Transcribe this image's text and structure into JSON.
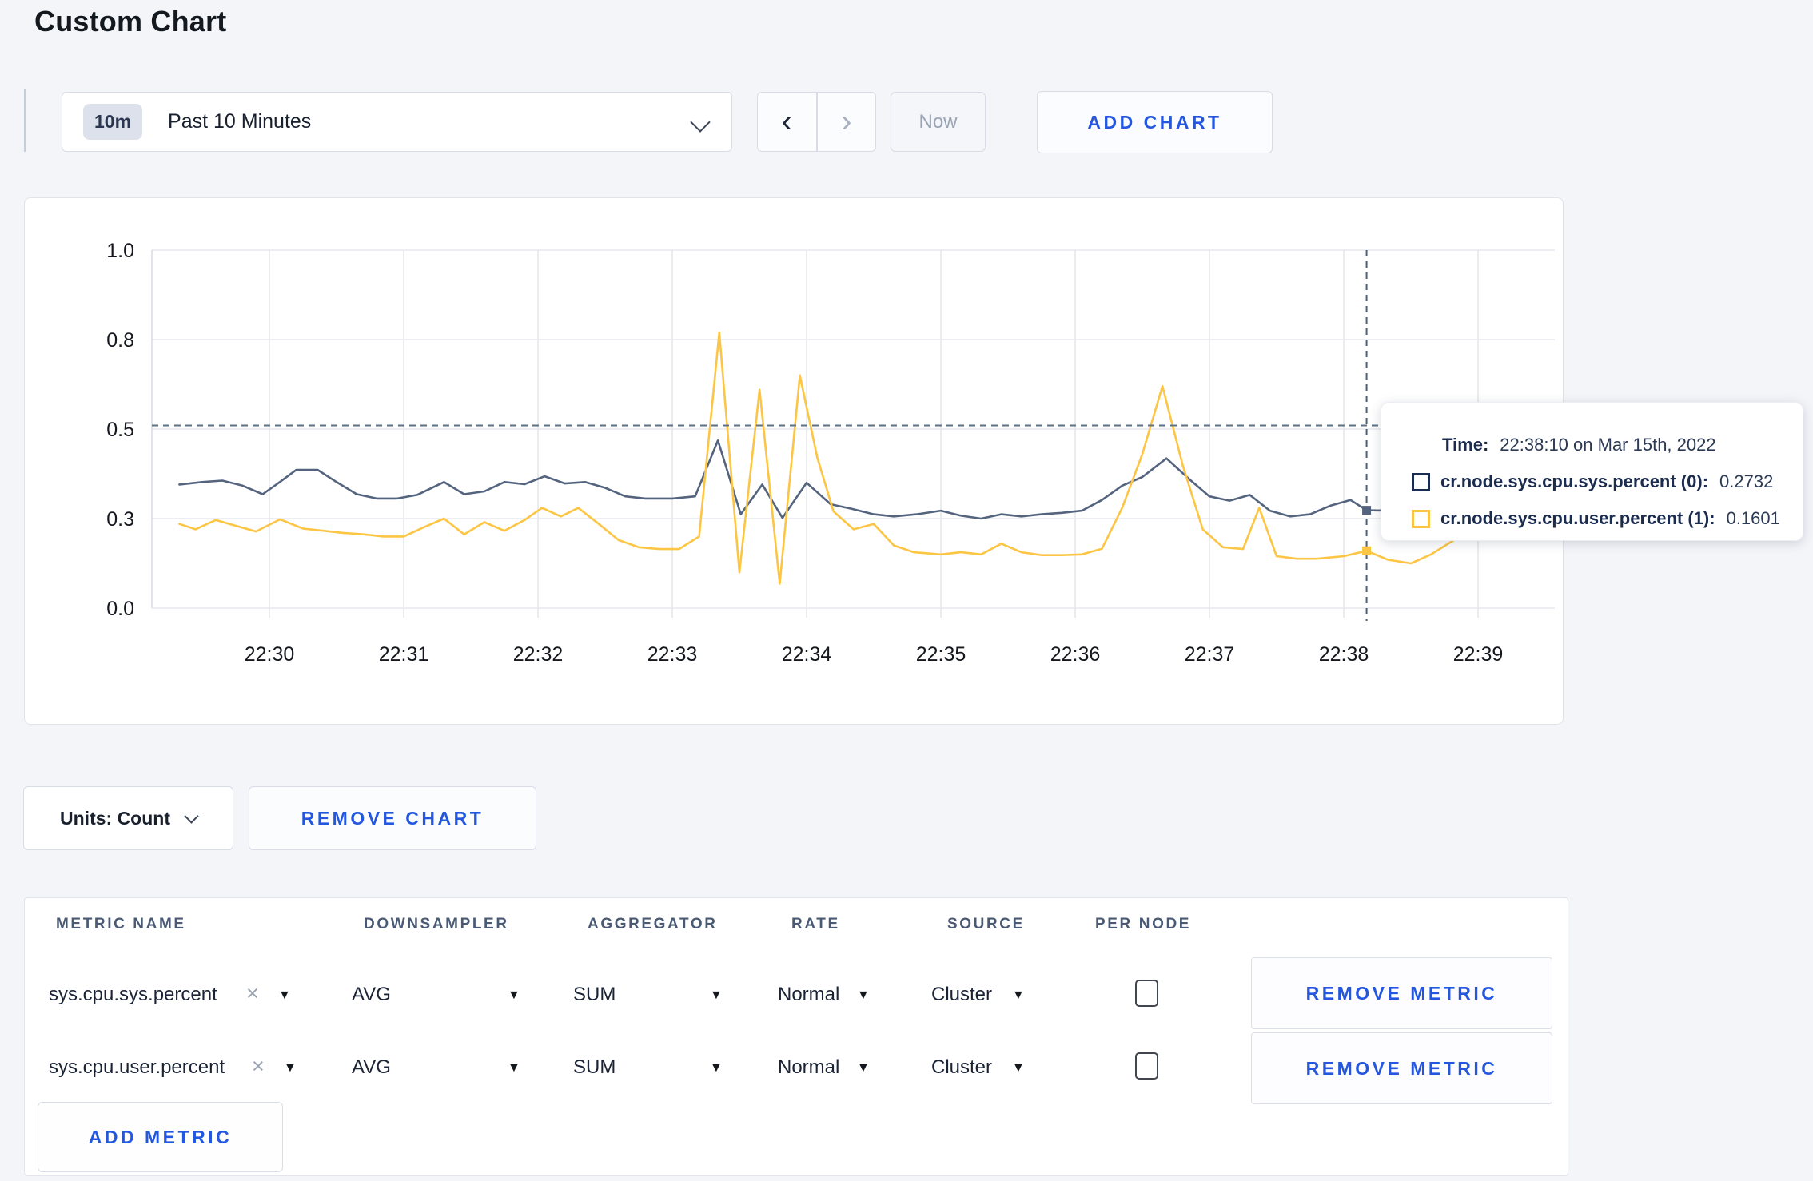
{
  "page": {
    "title": "Custom Chart",
    "accent_blue": "#2457e0",
    "background": "#f3f5f9"
  },
  "icons": {
    "chevron_left": "‹",
    "chevron_right": "›",
    "dropdown_caret": "▼",
    "remove_x": "×"
  },
  "toolbar": {
    "range_badge": "10m",
    "range_label": "Past 10 Minutes",
    "now_label": "Now",
    "add_chart_label": "ADD CHART"
  },
  "controls": {
    "units_label": "Units: Count",
    "remove_chart_label": "REMOVE CHART",
    "add_metric_label": "ADD METRIC"
  },
  "tooltip": {
    "time_label": "Time:",
    "time_value": "22:38:10 on Mar 15th, 2022",
    "entries": [
      {
        "label": "cr.node.sys.cpu.sys.percent (0):",
        "value": "0.2732",
        "color": "#1c2c4f"
      },
      {
        "label": "cr.node.sys.cpu.user.percent (1):",
        "value": "0.1601",
        "color": "#fdc544"
      }
    ]
  },
  "table": {
    "headers": [
      "METRIC NAME",
      "DOWNSAMPLER",
      "AGGREGATOR",
      "RATE",
      "SOURCE",
      "PER NODE"
    ],
    "remove_metric_label": "REMOVE METRIC",
    "metrics": [
      {
        "name": "sys.cpu.sys.percent",
        "downsampler": "AVG",
        "aggregator": "SUM",
        "rate": "Normal",
        "source": "Cluster",
        "per_node_checked": false
      },
      {
        "name": "sys.cpu.user.percent",
        "downsampler": "AVG",
        "aggregator": "SUM",
        "rate": "Normal",
        "source": "Cluster",
        "per_node_checked": false
      }
    ]
  },
  "chart_data": {
    "type": "line",
    "x_unit": "time (22:MM, fractional minutes)",
    "y_range": [
      0,
      1
    ],
    "grid": true,
    "x_ticks": [
      {
        "v": 30,
        "label": "22:30"
      },
      {
        "v": 31,
        "label": "22:31"
      },
      {
        "v": 32,
        "label": "22:32"
      },
      {
        "v": 33,
        "label": "22:33"
      },
      {
        "v": 34,
        "label": "22:34"
      },
      {
        "v": 35,
        "label": "22:35"
      },
      {
        "v": 36,
        "label": "22:36"
      },
      {
        "v": 37,
        "label": "22:37"
      },
      {
        "v": 38,
        "label": "22:38"
      },
      {
        "v": 39,
        "label": "22:39"
      }
    ],
    "y_ticks": [
      {
        "v": 0,
        "label": "0.0"
      },
      {
        "v": 0.25,
        "label": "0.3"
      },
      {
        "v": 0.5,
        "label": "0.5"
      },
      {
        "v": 0.75,
        "label": "0.8"
      },
      {
        "v": 1,
        "label": "1.0"
      }
    ],
    "crosshair": {
      "x": 38.17,
      "y": 0.51
    },
    "series": [
      {
        "name": "cr.node.sys.cpu.sys.percent",
        "color": "#54647e",
        "marker": {
          "x": 38.17,
          "y": 0.2732
        },
        "points": [
          [
            29.33,
            0.345
          ],
          [
            29.5,
            0.352
          ],
          [
            29.65,
            0.356
          ],
          [
            29.8,
            0.342
          ],
          [
            29.95,
            0.318
          ],
          [
            30.07,
            0.35
          ],
          [
            30.2,
            0.386
          ],
          [
            30.36,
            0.386
          ],
          [
            30.5,
            0.352
          ],
          [
            30.65,
            0.318
          ],
          [
            30.8,
            0.306
          ],
          [
            30.95,
            0.306
          ],
          [
            31.1,
            0.316
          ],
          [
            31.3,
            0.352
          ],
          [
            31.45,
            0.318
          ],
          [
            31.6,
            0.326
          ],
          [
            31.75,
            0.352
          ],
          [
            31.9,
            0.346
          ],
          [
            32.05,
            0.368
          ],
          [
            32.2,
            0.348
          ],
          [
            32.35,
            0.352
          ],
          [
            32.5,
            0.336
          ],
          [
            32.65,
            0.312
          ],
          [
            32.8,
            0.306
          ],
          [
            33.0,
            0.306
          ],
          [
            33.17,
            0.312
          ],
          [
            33.34,
            0.468
          ],
          [
            33.51,
            0.262
          ],
          [
            33.67,
            0.345
          ],
          [
            33.82,
            0.252
          ],
          [
            34.0,
            0.35
          ],
          [
            34.18,
            0.29
          ],
          [
            34.33,
            0.278
          ],
          [
            34.5,
            0.262
          ],
          [
            34.65,
            0.256
          ],
          [
            34.82,
            0.262
          ],
          [
            35.0,
            0.272
          ],
          [
            35.15,
            0.258
          ],
          [
            35.3,
            0.25
          ],
          [
            35.45,
            0.262
          ],
          [
            35.6,
            0.256
          ],
          [
            35.75,
            0.262
          ],
          [
            35.9,
            0.266
          ],
          [
            36.05,
            0.272
          ],
          [
            36.2,
            0.302
          ],
          [
            36.35,
            0.342
          ],
          [
            36.5,
            0.366
          ],
          [
            36.68,
            0.418
          ],
          [
            36.85,
            0.36
          ],
          [
            37.0,
            0.312
          ],
          [
            37.15,
            0.3
          ],
          [
            37.3,
            0.316
          ],
          [
            37.45,
            0.272
          ],
          [
            37.6,
            0.256
          ],
          [
            37.75,
            0.262
          ],
          [
            37.9,
            0.286
          ],
          [
            38.05,
            0.302
          ],
          [
            38.17,
            0.2732
          ],
          [
            38.33,
            0.272
          ],
          [
            38.5,
            0.296
          ],
          [
            38.65,
            0.302
          ],
          [
            38.82,
            0.296
          ],
          [
            39.0,
            0.302
          ],
          [
            39.15,
            0.302
          ],
          [
            39.3,
            0.308
          ],
          [
            39.42,
            0.312
          ]
        ]
      },
      {
        "name": "cr.node.sys.cpu.user.percent",
        "color": "#fdc544",
        "marker": {
          "x": 38.17,
          "y": 0.1601
        },
        "points": [
          [
            29.33,
            0.235
          ],
          [
            29.45,
            0.22
          ],
          [
            29.6,
            0.246
          ],
          [
            29.75,
            0.23
          ],
          [
            29.9,
            0.214
          ],
          [
            30.08,
            0.248
          ],
          [
            30.25,
            0.222
          ],
          [
            30.4,
            0.216
          ],
          [
            30.55,
            0.21
          ],
          [
            30.7,
            0.206
          ],
          [
            30.85,
            0.2
          ],
          [
            31.0,
            0.2
          ],
          [
            31.15,
            0.226
          ],
          [
            31.3,
            0.25
          ],
          [
            31.45,
            0.206
          ],
          [
            31.6,
            0.24
          ],
          [
            31.75,
            0.216
          ],
          [
            31.9,
            0.246
          ],
          [
            32.03,
            0.28
          ],
          [
            32.17,
            0.256
          ],
          [
            32.3,
            0.28
          ],
          [
            32.45,
            0.236
          ],
          [
            32.6,
            0.19
          ],
          [
            32.75,
            0.17
          ],
          [
            32.9,
            0.165
          ],
          [
            33.05,
            0.165
          ],
          [
            33.2,
            0.2
          ],
          [
            33.35,
            0.77
          ],
          [
            33.5,
            0.1
          ],
          [
            33.65,
            0.61
          ],
          [
            33.8,
            0.068
          ],
          [
            33.95,
            0.65
          ],
          [
            34.08,
            0.42
          ],
          [
            34.2,
            0.27
          ],
          [
            34.35,
            0.22
          ],
          [
            34.5,
            0.235
          ],
          [
            34.65,
            0.175
          ],
          [
            34.8,
            0.156
          ],
          [
            35.0,
            0.15
          ],
          [
            35.15,
            0.156
          ],
          [
            35.3,
            0.15
          ],
          [
            35.45,
            0.18
          ],
          [
            35.6,
            0.156
          ],
          [
            35.75,
            0.148
          ],
          [
            35.9,
            0.148
          ],
          [
            36.05,
            0.15
          ],
          [
            36.2,
            0.166
          ],
          [
            36.35,
            0.28
          ],
          [
            36.5,
            0.43
          ],
          [
            36.65,
            0.62
          ],
          [
            36.8,
            0.4
          ],
          [
            36.95,
            0.22
          ],
          [
            37.1,
            0.17
          ],
          [
            37.25,
            0.165
          ],
          [
            37.37,
            0.28
          ],
          [
            37.5,
            0.145
          ],
          [
            37.65,
            0.138
          ],
          [
            37.8,
            0.138
          ],
          [
            38.0,
            0.145
          ],
          [
            38.17,
            0.1601
          ],
          [
            38.33,
            0.135
          ],
          [
            38.5,
            0.125
          ],
          [
            38.65,
            0.15
          ],
          [
            38.82,
            0.19
          ],
          [
            39.0,
            0.235
          ],
          [
            39.15,
            0.27
          ],
          [
            39.3,
            0.24
          ],
          [
            39.42,
            0.22
          ]
        ]
      }
    ]
  }
}
